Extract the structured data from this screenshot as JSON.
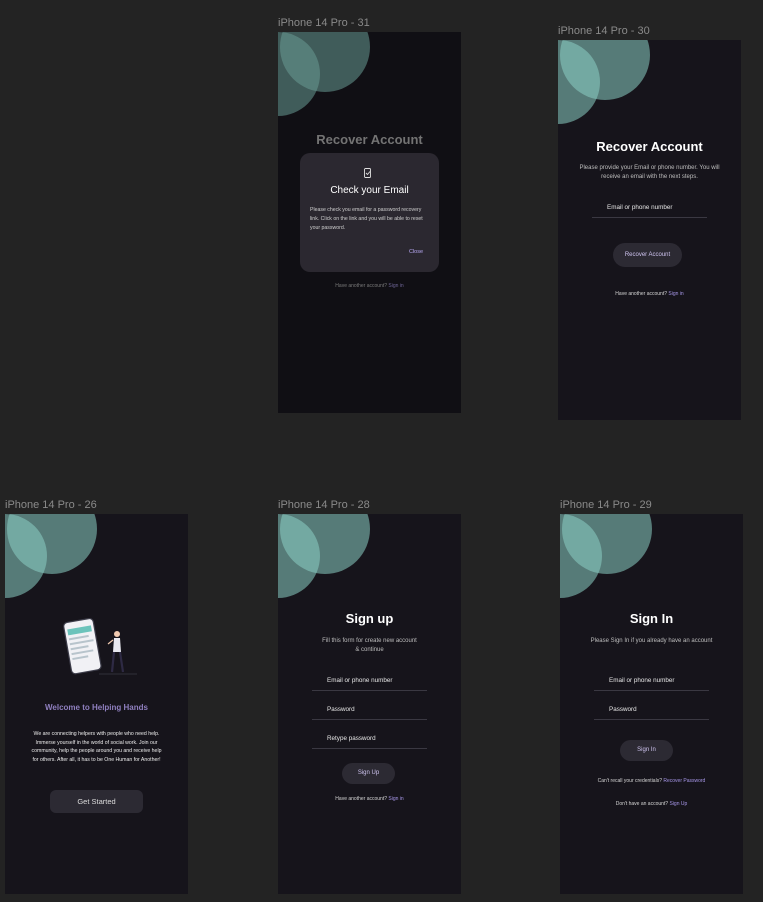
{
  "frames": {
    "f31": {
      "label": "iPhone 14 Pro - 31"
    },
    "f30": {
      "label": "iPhone 14 Pro - 30"
    },
    "f26": {
      "label": "iPhone 14 Pro - 26"
    },
    "f28": {
      "label": "iPhone 14 Pro - 28"
    },
    "f29": {
      "label": "iPhone 14 Pro - 29"
    }
  },
  "recover_dialog": {
    "page_title": "Recover Account",
    "dialog_title": "Check your Email",
    "dialog_body": "Please check you email for a password recovery link. Click on the link and you will be able to reset your password.",
    "close_label": "Close",
    "footer_text": "Have another account?",
    "footer_link": "Sign in"
  },
  "recover": {
    "title": "Recover Account",
    "subtitle": "Please provide your Email or phone number. You will receive an email with the next steps.",
    "field_email": "Email or phone number",
    "button_label": "Recover Account",
    "footer_text": "Have another account?",
    "footer_link": "Sign in"
  },
  "welcome": {
    "title": "Welcome to Helping Hands",
    "body": "We are connecting helpers with people who need help. Immerse yourself in the world of social work. Join our community, help the people around you and receive help for others. After all, it has to be One Human for Another!",
    "button_label": "Get Started"
  },
  "signup": {
    "title": "Sign up",
    "subtitle": "Fill this form for create new account & continue",
    "field_email": "Email or phone number",
    "field_password": "Password",
    "field_retype": "Retype password",
    "button_label": "Sign Up",
    "footer_text": "Have another account?",
    "footer_link": "Sign in"
  },
  "signin": {
    "title": "Sign In",
    "subtitle": "Please Sign In if you already have an account",
    "field_email": "Email or phone number",
    "field_password": "Password",
    "button_label": "Sign In",
    "recall_text": "Can't recall your credentials?",
    "recall_link": "Recover Password",
    "footer_text": "Don't have an account?",
    "footer_link": "Sign Up"
  },
  "colors": {
    "canvas": "#232323",
    "frame_bg": "#16141b",
    "accent_circle": "#8dcfc4",
    "link": "#a595e6",
    "welcome_title": "#8f7fbf"
  }
}
